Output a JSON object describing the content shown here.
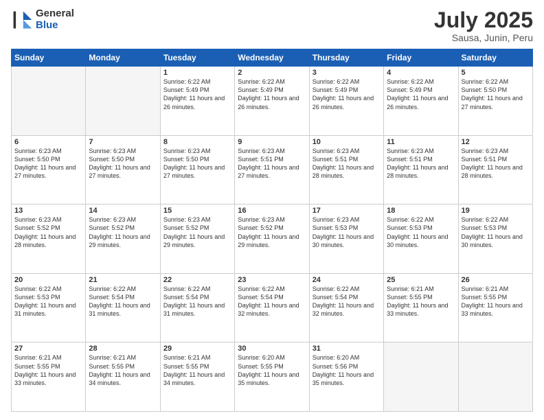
{
  "logo": {
    "general": "General",
    "blue": "Blue"
  },
  "title": {
    "month": "July 2025",
    "location": "Sausa, Junin, Peru"
  },
  "days_of_week": [
    "Sunday",
    "Monday",
    "Tuesday",
    "Wednesday",
    "Thursday",
    "Friday",
    "Saturday"
  ],
  "weeks": [
    [
      {
        "day": "",
        "info": ""
      },
      {
        "day": "",
        "info": ""
      },
      {
        "day": "1",
        "info": "Sunrise: 6:22 AM\nSunset: 5:49 PM\nDaylight: 11 hours and 26 minutes."
      },
      {
        "day": "2",
        "info": "Sunrise: 6:22 AM\nSunset: 5:49 PM\nDaylight: 11 hours and 26 minutes."
      },
      {
        "day": "3",
        "info": "Sunrise: 6:22 AM\nSunset: 5:49 PM\nDaylight: 11 hours and 26 minutes."
      },
      {
        "day": "4",
        "info": "Sunrise: 6:22 AM\nSunset: 5:49 PM\nDaylight: 11 hours and 26 minutes."
      },
      {
        "day": "5",
        "info": "Sunrise: 6:22 AM\nSunset: 5:50 PM\nDaylight: 11 hours and 27 minutes."
      }
    ],
    [
      {
        "day": "6",
        "info": "Sunrise: 6:23 AM\nSunset: 5:50 PM\nDaylight: 11 hours and 27 minutes."
      },
      {
        "day": "7",
        "info": "Sunrise: 6:23 AM\nSunset: 5:50 PM\nDaylight: 11 hours and 27 minutes."
      },
      {
        "day": "8",
        "info": "Sunrise: 6:23 AM\nSunset: 5:50 PM\nDaylight: 11 hours and 27 minutes."
      },
      {
        "day": "9",
        "info": "Sunrise: 6:23 AM\nSunset: 5:51 PM\nDaylight: 11 hours and 27 minutes."
      },
      {
        "day": "10",
        "info": "Sunrise: 6:23 AM\nSunset: 5:51 PM\nDaylight: 11 hours and 28 minutes."
      },
      {
        "day": "11",
        "info": "Sunrise: 6:23 AM\nSunset: 5:51 PM\nDaylight: 11 hours and 28 minutes."
      },
      {
        "day": "12",
        "info": "Sunrise: 6:23 AM\nSunset: 5:51 PM\nDaylight: 11 hours and 28 minutes."
      }
    ],
    [
      {
        "day": "13",
        "info": "Sunrise: 6:23 AM\nSunset: 5:52 PM\nDaylight: 11 hours and 28 minutes."
      },
      {
        "day": "14",
        "info": "Sunrise: 6:23 AM\nSunset: 5:52 PM\nDaylight: 11 hours and 29 minutes."
      },
      {
        "day": "15",
        "info": "Sunrise: 6:23 AM\nSunset: 5:52 PM\nDaylight: 11 hours and 29 minutes."
      },
      {
        "day": "16",
        "info": "Sunrise: 6:23 AM\nSunset: 5:52 PM\nDaylight: 11 hours and 29 minutes."
      },
      {
        "day": "17",
        "info": "Sunrise: 6:23 AM\nSunset: 5:53 PM\nDaylight: 11 hours and 30 minutes."
      },
      {
        "day": "18",
        "info": "Sunrise: 6:22 AM\nSunset: 5:53 PM\nDaylight: 11 hours and 30 minutes."
      },
      {
        "day": "19",
        "info": "Sunrise: 6:22 AM\nSunset: 5:53 PM\nDaylight: 11 hours and 30 minutes."
      }
    ],
    [
      {
        "day": "20",
        "info": "Sunrise: 6:22 AM\nSunset: 5:53 PM\nDaylight: 11 hours and 31 minutes."
      },
      {
        "day": "21",
        "info": "Sunrise: 6:22 AM\nSunset: 5:54 PM\nDaylight: 11 hours and 31 minutes."
      },
      {
        "day": "22",
        "info": "Sunrise: 6:22 AM\nSunset: 5:54 PM\nDaylight: 11 hours and 31 minutes."
      },
      {
        "day": "23",
        "info": "Sunrise: 6:22 AM\nSunset: 5:54 PM\nDaylight: 11 hours and 32 minutes."
      },
      {
        "day": "24",
        "info": "Sunrise: 6:22 AM\nSunset: 5:54 PM\nDaylight: 11 hours and 32 minutes."
      },
      {
        "day": "25",
        "info": "Sunrise: 6:21 AM\nSunset: 5:55 PM\nDaylight: 11 hours and 33 minutes."
      },
      {
        "day": "26",
        "info": "Sunrise: 6:21 AM\nSunset: 5:55 PM\nDaylight: 11 hours and 33 minutes."
      }
    ],
    [
      {
        "day": "27",
        "info": "Sunrise: 6:21 AM\nSunset: 5:55 PM\nDaylight: 11 hours and 33 minutes."
      },
      {
        "day": "28",
        "info": "Sunrise: 6:21 AM\nSunset: 5:55 PM\nDaylight: 11 hours and 34 minutes."
      },
      {
        "day": "29",
        "info": "Sunrise: 6:21 AM\nSunset: 5:55 PM\nDaylight: 11 hours and 34 minutes."
      },
      {
        "day": "30",
        "info": "Sunrise: 6:20 AM\nSunset: 5:55 PM\nDaylight: 11 hours and 35 minutes."
      },
      {
        "day": "31",
        "info": "Sunrise: 6:20 AM\nSunset: 5:56 PM\nDaylight: 11 hours and 35 minutes."
      },
      {
        "day": "",
        "info": ""
      },
      {
        "day": "",
        "info": ""
      }
    ]
  ]
}
